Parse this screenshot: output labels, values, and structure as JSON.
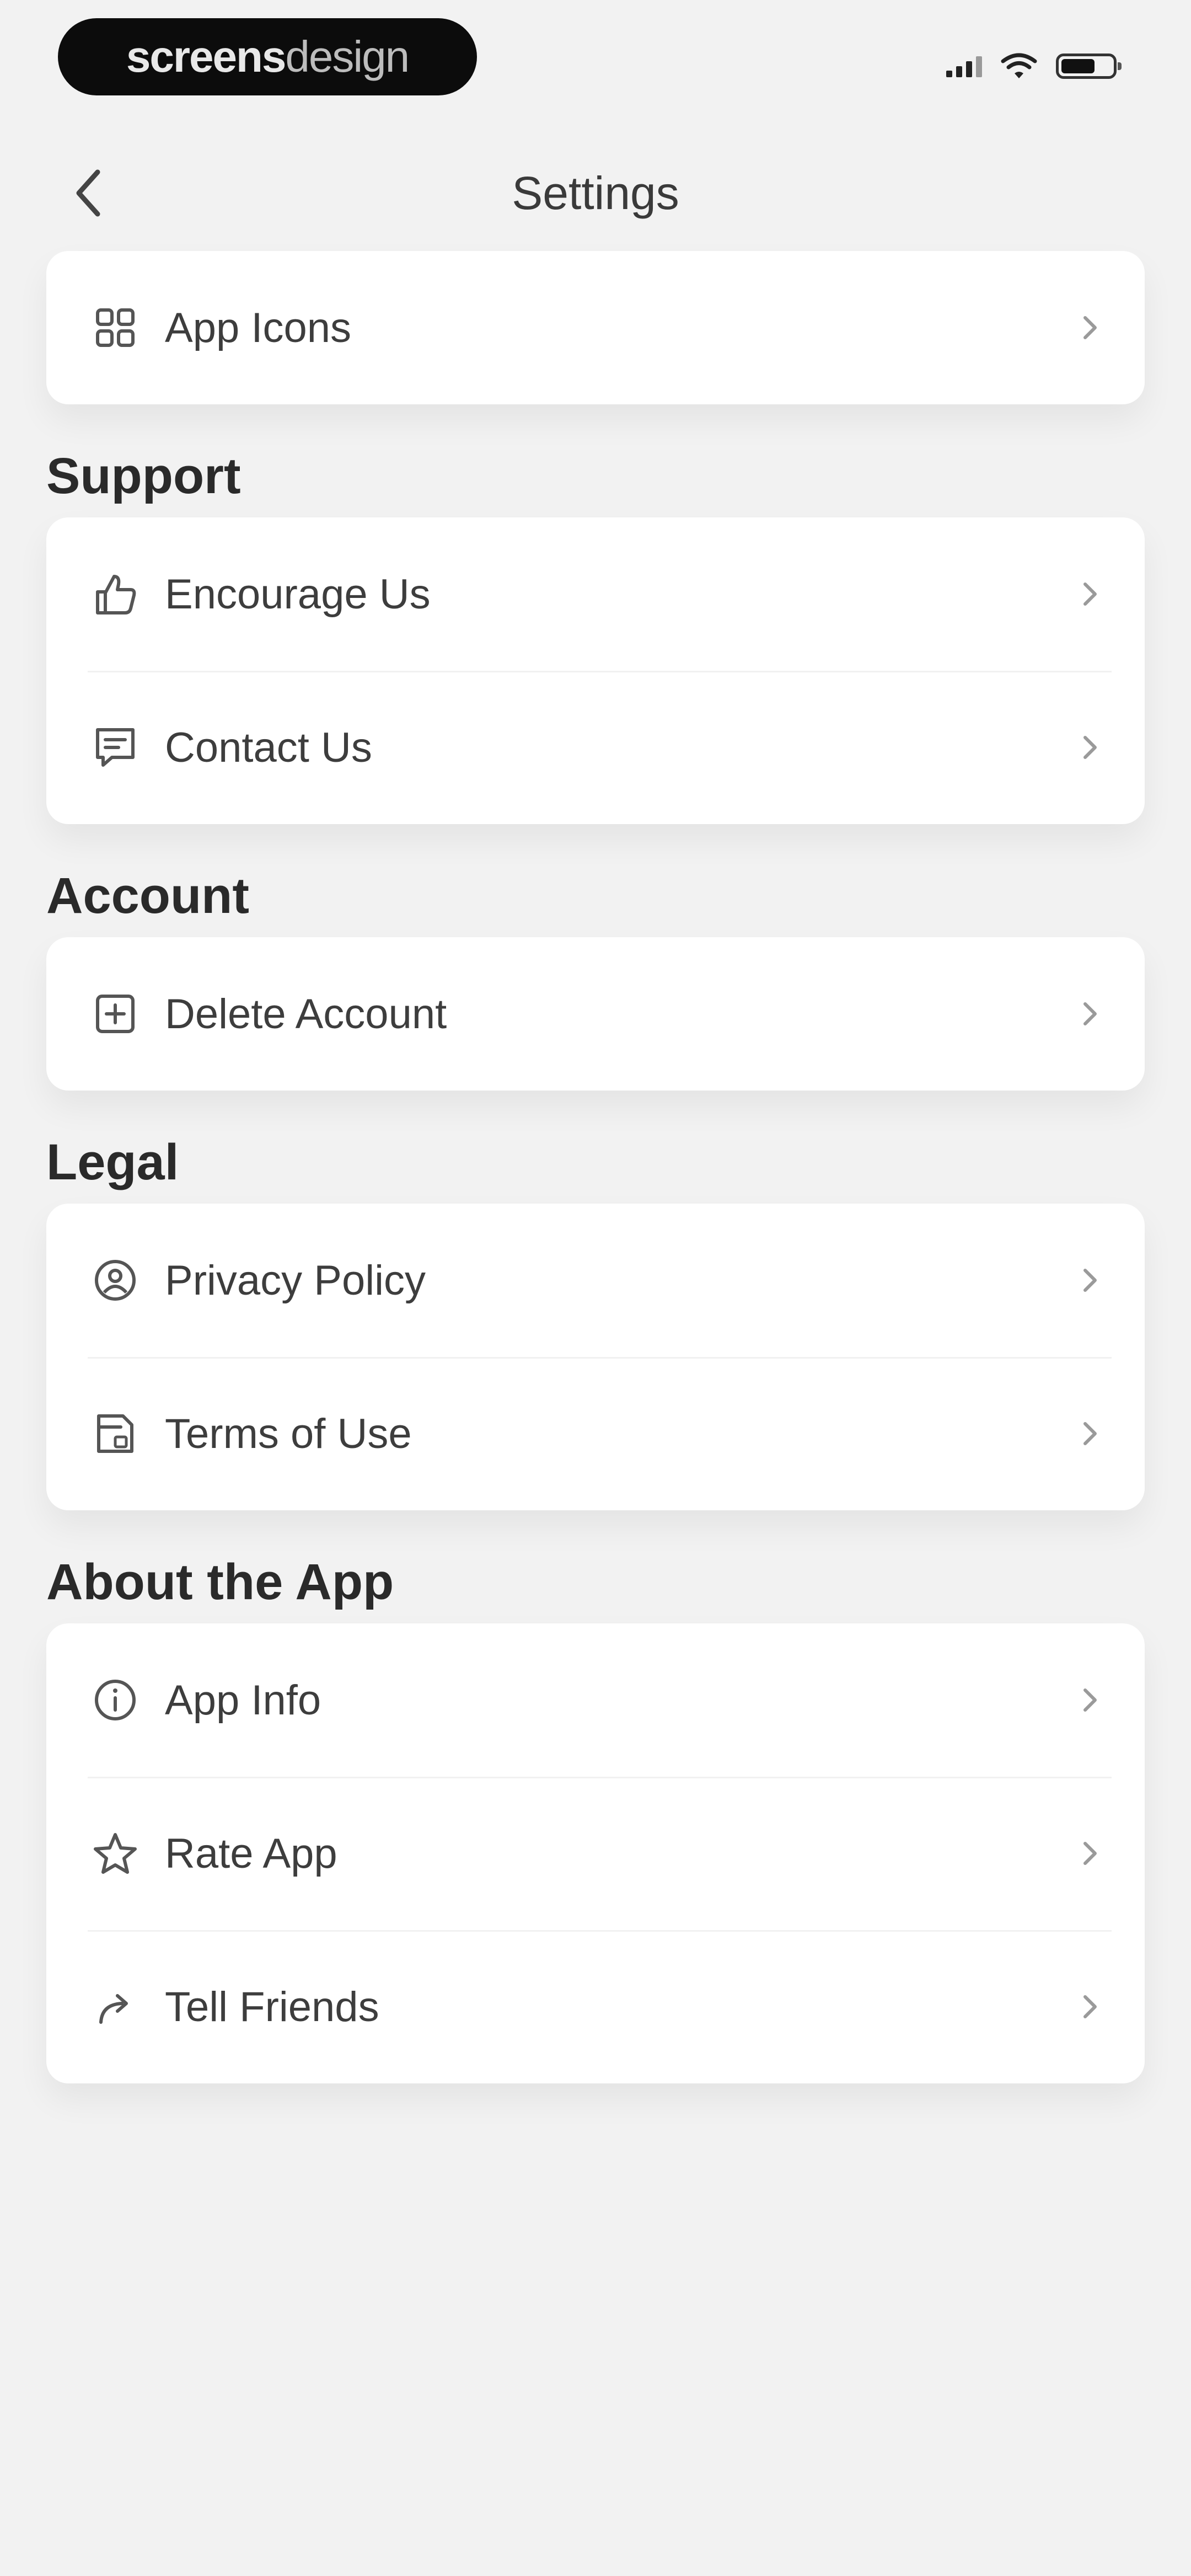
{
  "status_bar": {
    "brand_bold": "screens",
    "brand_light": "design"
  },
  "nav": {
    "title": "Settings"
  },
  "sections": {
    "top": {
      "items": [
        {
          "label": "App Icons",
          "icon": "app-grid-icon"
        }
      ]
    },
    "support": {
      "title": "Support",
      "items": [
        {
          "label": "Encourage Us",
          "icon": "thumbs-up-icon"
        },
        {
          "label": "Contact Us",
          "icon": "message-icon"
        }
      ]
    },
    "account": {
      "title": "Account",
      "items": [
        {
          "label": "Delete Account",
          "icon": "delete-account-icon"
        }
      ]
    },
    "legal": {
      "title": "Legal",
      "items": [
        {
          "label": "Privacy Policy",
          "icon": "privacy-shield-icon"
        },
        {
          "label": "Terms of Use",
          "icon": "document-icon"
        }
      ]
    },
    "about": {
      "title": "About the App",
      "items": [
        {
          "label": "App Info",
          "icon": "info-icon"
        },
        {
          "label": "Rate App",
          "icon": "star-icon"
        },
        {
          "label": "Tell Friends",
          "icon": "share-arrow-icon"
        }
      ]
    }
  },
  "colors": {
    "background": "#f2f2f2",
    "card": "#ffffff",
    "text": "#3d3d3d",
    "section_title": "#2a2a2a",
    "chevron": "#9a9a9a"
  }
}
